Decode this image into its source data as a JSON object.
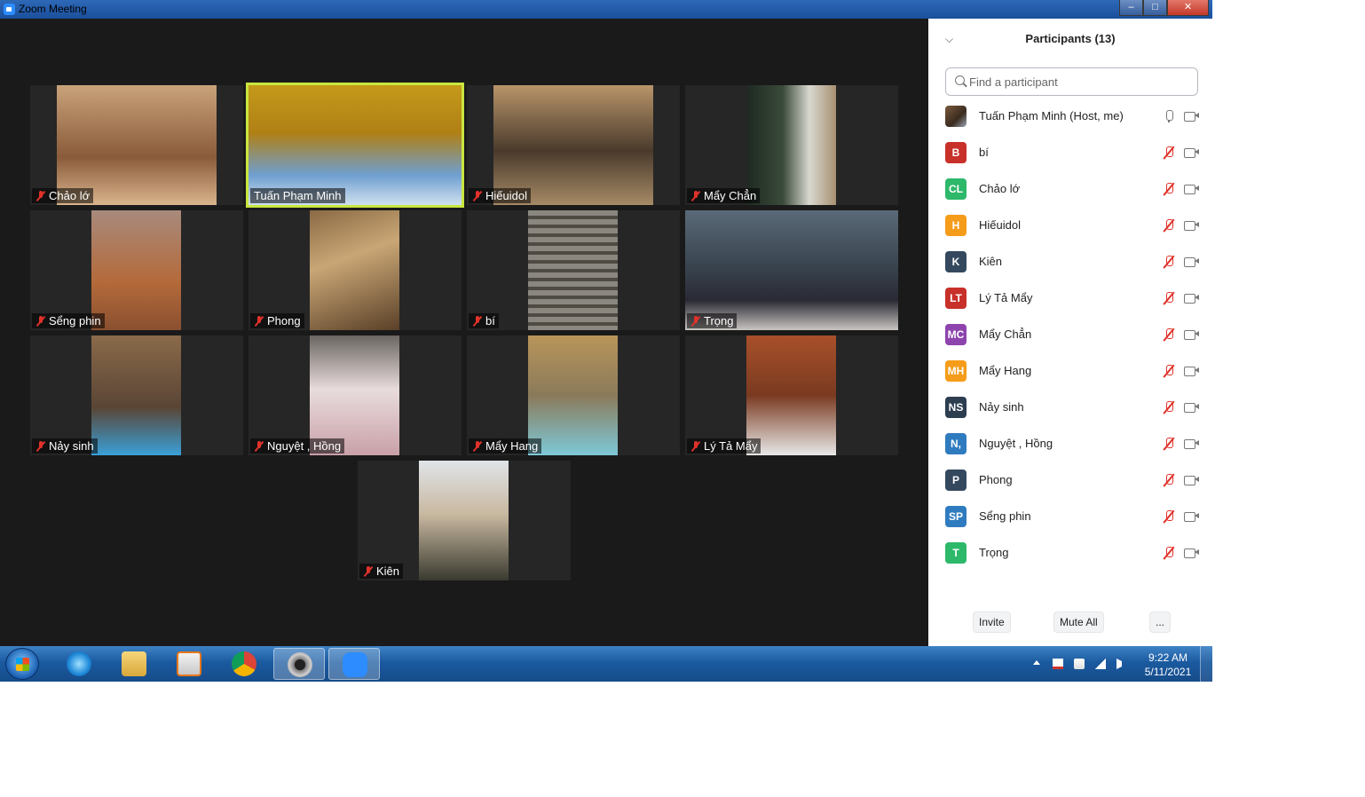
{
  "window": {
    "title": "Zoom Meeting",
    "controls": [
      "–",
      "□",
      "✕"
    ]
  },
  "tiles": [
    {
      "name": "Chảo lớ",
      "muted": true
    },
    {
      "name": "Tuấn Phạm Minh",
      "muted": false,
      "active": true
    },
    {
      "name": "Hiếuidol",
      "muted": true
    },
    {
      "name": "Mẩy Chẳn",
      "muted": true
    },
    {
      "name": "Sểng phin",
      "muted": true
    },
    {
      "name": "Phong",
      "muted": true
    },
    {
      "name": "bí",
      "muted": true
    },
    {
      "name": "Trọng",
      "muted": true
    },
    {
      "name": "Nảy sinh",
      "muted": true
    },
    {
      "name": "Nguyệt , Hồng",
      "muted": true
    },
    {
      "name": "Mẩy Hang",
      "muted": true
    },
    {
      "name": "Lý Tả Mẩy",
      "muted": true
    },
    {
      "name": "Kiên",
      "muted": true
    }
  ],
  "panel": {
    "title": "Participants (13)",
    "collapse_icon": "chevron-down-icon",
    "search_placeholder": "Find a participant",
    "participants": [
      {
        "initials": "",
        "name": "Tuấn Phạm Minh (Host, me)",
        "color": "#6b4e35",
        "photo": true,
        "mic": "on"
      },
      {
        "initials": "B",
        "name": "bí",
        "color": "#c8302a",
        "mic": "off"
      },
      {
        "initials": "CL",
        "name": "Chảo lớ",
        "color": "#2db86a",
        "mic": "off"
      },
      {
        "initials": "H",
        "name": "Hiếuidol",
        "color": "#f59c1a",
        "mic": "off"
      },
      {
        "initials": "K",
        "name": "Kiên",
        "color": "#34495e",
        "mic": "off"
      },
      {
        "initials": "LT",
        "name": "Lý Tả Mẩy",
        "color": "#c8302a",
        "mic": "off"
      },
      {
        "initials": "MC",
        "name": "Mẩy Chẳn",
        "color": "#8e44ad",
        "mic": "off"
      },
      {
        "initials": "MH",
        "name": "Mẩy Hang",
        "color": "#f59c1a",
        "mic": "off"
      },
      {
        "initials": "NS",
        "name": "Nảy sinh",
        "color": "#2c3e50",
        "mic": "off"
      },
      {
        "initials": "N,",
        "name": "Nguyệt , Hồng",
        "color": "#2f7bbf",
        "mic": "off"
      },
      {
        "initials": "P",
        "name": "Phong",
        "color": "#34495e",
        "mic": "off"
      },
      {
        "initials": "SP",
        "name": "Sểng phin",
        "color": "#2f7bbf",
        "mic": "off"
      },
      {
        "initials": "T",
        "name": "Trọng",
        "color": "#2db86a",
        "mic": "off"
      }
    ],
    "actions": {
      "invite": "Invite",
      "mute_all": "Mute All",
      "more": "..."
    }
  },
  "taskbar": {
    "apps": [
      "internet-explorer-icon",
      "file-explorer-icon",
      "media-player-icon",
      "chrome-icon",
      "camera-app-icon",
      "zoom-icon"
    ],
    "clock": {
      "time": "9:22 AM",
      "date": "5/11/2021"
    }
  }
}
